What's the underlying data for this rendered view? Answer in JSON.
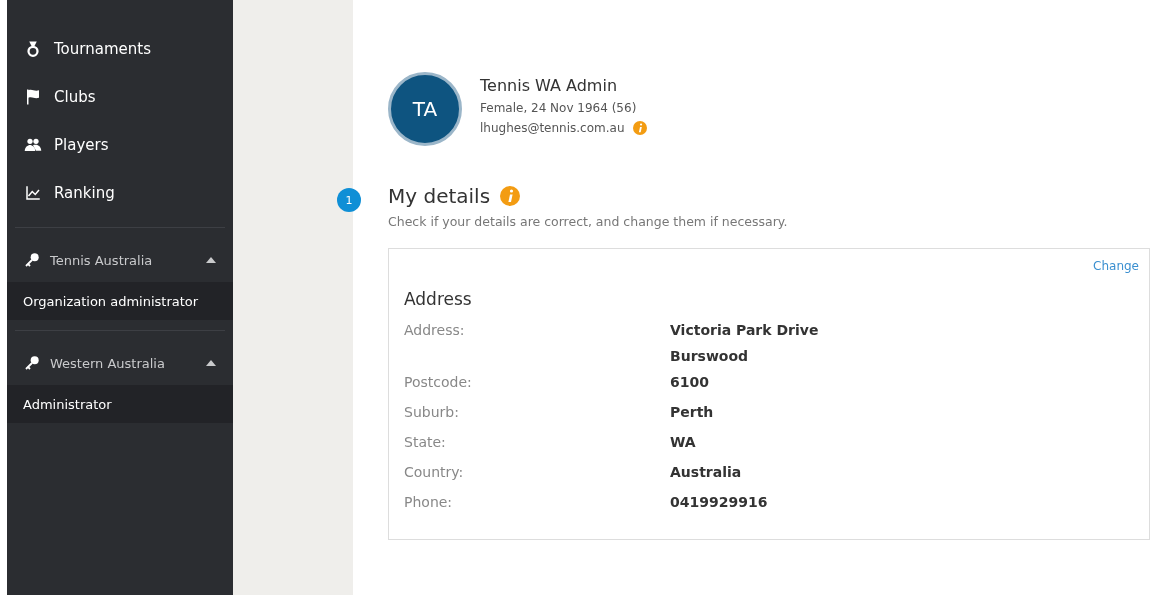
{
  "sidebar": {
    "items": [
      {
        "kind": "medal",
        "label": "Tournaments"
      },
      {
        "kind": "flag",
        "label": "Clubs"
      },
      {
        "kind": "people",
        "label": "Players"
      },
      {
        "kind": "chart",
        "label": "Ranking"
      }
    ],
    "groups": [
      {
        "label": "Tennis Australia",
        "expanded": true,
        "roles": [
          "Organization administrator"
        ]
      },
      {
        "label": "Western Australia",
        "expanded": true,
        "roles": [
          "Administrator"
        ]
      }
    ]
  },
  "profile": {
    "initials": "TA",
    "name": "Tennis WA Admin",
    "details": "Female, 24 Nov 1964 (56)",
    "email": "lhughes@tennis.com.au"
  },
  "section": {
    "step": "1",
    "title": "My details",
    "subtitle": "Check if your details are correct, and change them if necessary.",
    "card": {
      "action": "Change",
      "heading": "Address",
      "rows": [
        {
          "label": "Address:",
          "values": [
            "Victoria Park Drive",
            "Burswood"
          ]
        },
        {
          "label": "Postcode:",
          "values": [
            "6100"
          ]
        },
        {
          "label": "Suburb:",
          "values": [
            "Perth"
          ]
        },
        {
          "label": "State:",
          "values": [
            "WA"
          ]
        },
        {
          "label": "Country:",
          "values": [
            "Australia"
          ]
        },
        {
          "label": "Phone:",
          "values": [
            "0419929916"
          ]
        }
      ]
    }
  }
}
